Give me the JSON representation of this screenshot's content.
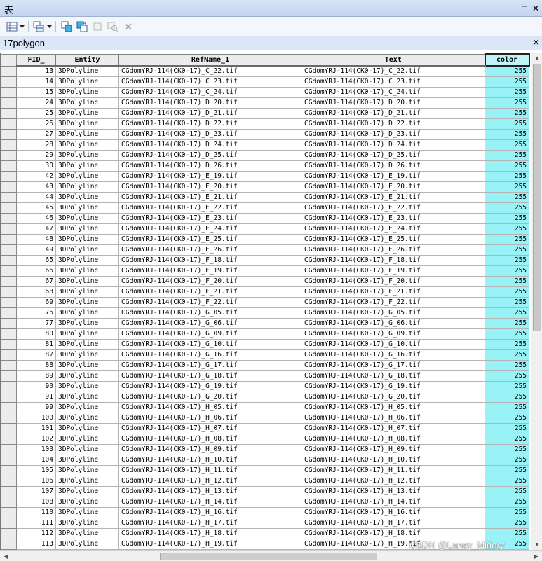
{
  "window": {
    "title": "表",
    "buttons": {
      "maximize": "□",
      "close": "✕"
    }
  },
  "tab": {
    "name": "17polygon",
    "close": "✕"
  },
  "table": {
    "columns": [
      "FID_",
      "Entity",
      "RefName_1",
      "Text",
      "color"
    ],
    "rows": [
      [
        "13",
        "3DPolyline",
        "CGdomYRJ-114(CK0-17)_C_22.tif",
        "CGdomYRJ-114(CK0-17)_C_22.tif",
        "255"
      ],
      [
        "14",
        "3DPolyline",
        "CGdomYRJ-114(CK0-17)_C_23.tif",
        "CGdomYRJ-114(CK0-17)_C_23.tif",
        "255"
      ],
      [
        "15",
        "3DPolyline",
        "CGdomYRJ-114(CK0-17)_C_24.tif",
        "CGdomYRJ-114(CK0-17)_C_24.tif",
        "255"
      ],
      [
        "24",
        "3DPolyline",
        "CGdomYRJ-114(CK0-17)_D_20.tif",
        "CGdomYRJ-114(CK0-17)_D_20.tif",
        "255"
      ],
      [
        "25",
        "3DPolyline",
        "CGdomYRJ-114(CK0-17)_D_21.tif",
        "CGdomYRJ-114(CK0-17)_D_21.tif",
        "255"
      ],
      [
        "26",
        "3DPolyline",
        "CGdomYRJ-114(CK0-17)_D_22.tif",
        "CGdomYRJ-114(CK0-17)_D_22.tif",
        "255"
      ],
      [
        "27",
        "3DPolyline",
        "CGdomYRJ-114(CK0-17)_D_23.tif",
        "CGdomYRJ-114(CK0-17)_D_23.tif",
        "255"
      ],
      [
        "28",
        "3DPolyline",
        "CGdomYRJ-114(CK0-17)_D_24.tif",
        "CGdomYRJ-114(CK0-17)_D_24.tif",
        "255"
      ],
      [
        "29",
        "3DPolyline",
        "CGdomYRJ-114(CK0-17)_D_25.tif",
        "CGdomYRJ-114(CK0-17)_D_25.tif",
        "255"
      ],
      [
        "30",
        "3DPolyline",
        "CGdomYRJ-114(CK0-17)_D_26.tif",
        "CGdomYRJ-114(CK0-17)_D_26.tif",
        "255"
      ],
      [
        "42",
        "3DPolyline",
        "CGdomYRJ-114(CK0-17)_E_19.tif",
        "CGdomYRJ-114(CK0-17)_E_19.tif",
        "255"
      ],
      [
        "43",
        "3DPolyline",
        "CGdomYRJ-114(CK0-17)_E_20.tif",
        "CGdomYRJ-114(CK0-17)_E_20.tif",
        "255"
      ],
      [
        "44",
        "3DPolyline",
        "CGdomYRJ-114(CK0-17)_E_21.tif",
        "CGdomYRJ-114(CK0-17)_E_21.tif",
        "255"
      ],
      [
        "45",
        "3DPolyline",
        "CGdomYRJ-114(CK0-17)_E_22.tif",
        "CGdomYRJ-114(CK0-17)_E_22.tif",
        "255"
      ],
      [
        "46",
        "3DPolyline",
        "CGdomYRJ-114(CK0-17)_E_23.tif",
        "CGdomYRJ-114(CK0-17)_E_23.tif",
        "255"
      ],
      [
        "47",
        "3DPolyline",
        "CGdomYRJ-114(CK0-17)_E_24.tif",
        "CGdomYRJ-114(CK0-17)_E_24.tif",
        "255"
      ],
      [
        "48",
        "3DPolyline",
        "CGdomYRJ-114(CK0-17)_E_25.tif",
        "CGdomYRJ-114(CK0-17)_E_25.tif",
        "255"
      ],
      [
        "49",
        "3DPolyline",
        "CGdomYRJ-114(CK0-17)_E_26.tif",
        "CGdomYRJ-114(CK0-17)_E_26.tif",
        "255"
      ],
      [
        "65",
        "3DPolyline",
        "CGdomYRJ-114(CK0-17)_F_18.tif",
        "CGdomYRJ-114(CK0-17)_F_18.tif",
        "255"
      ],
      [
        "66",
        "3DPolyline",
        "CGdomYRJ-114(CK0-17)_F_19.tif",
        "CGdomYRJ-114(CK0-17)_F_19.tif",
        "255"
      ],
      [
        "67",
        "3DPolyline",
        "CGdomYRJ-114(CK0-17)_F_20.tif",
        "CGdomYRJ-114(CK0-17)_F_20.tif",
        "255"
      ],
      [
        "68",
        "3DPolyline",
        "CGdomYRJ-114(CK0-17)_F_21.tif",
        "CGdomYRJ-114(CK0-17)_F_21.tif",
        "255"
      ],
      [
        "69",
        "3DPolyline",
        "CGdomYRJ-114(CK0-17)_F_22.tif",
        "CGdomYRJ-114(CK0-17)_F_22.tif",
        "255"
      ],
      [
        "76",
        "3DPolyline",
        "CGdomYRJ-114(CK0-17)_G_05.tif",
        "CGdomYRJ-114(CK0-17)_G_05.tif",
        "255"
      ],
      [
        "77",
        "3DPolyline",
        "CGdomYRJ-114(CK0-17)_G_06.tif",
        "CGdomYRJ-114(CK0-17)_G_06.tif",
        "255"
      ],
      [
        "80",
        "3DPolyline",
        "CGdomYRJ-114(CK0-17)_G_09.tif",
        "CGdomYRJ-114(CK0-17)_G_09.tif",
        "255"
      ],
      [
        "81",
        "3DPolyline",
        "CGdomYRJ-114(CK0-17)_G_10.tif",
        "CGdomYRJ-114(CK0-17)_G_10.tif",
        "255"
      ],
      [
        "87",
        "3DPolyline",
        "CGdomYRJ-114(CK0-17)_G_16.tif",
        "CGdomYRJ-114(CK0-17)_G_16.tif",
        "255"
      ],
      [
        "88",
        "3DPolyline",
        "CGdomYRJ-114(CK0-17)_G_17.tif",
        "CGdomYRJ-114(CK0-17)_G_17.tif",
        "255"
      ],
      [
        "89",
        "3DPolyline",
        "CGdomYRJ-114(CK0-17)_G_18.tif",
        "CGdomYRJ-114(CK0-17)_G_18.tif",
        "255"
      ],
      [
        "90",
        "3DPolyline",
        "CGdomYRJ-114(CK0-17)_G_19.tif",
        "CGdomYRJ-114(CK0-17)_G_19.tif",
        "255"
      ],
      [
        "91",
        "3DPolyline",
        "CGdomYRJ-114(CK0-17)_G_20.tif",
        "CGdomYRJ-114(CK0-17)_G_20.tif",
        "255"
      ],
      [
        "99",
        "3DPolyline",
        "CGdomYRJ-114(CK0-17)_H_05.tif",
        "CGdomYRJ-114(CK0-17)_H_05.tif",
        "255"
      ],
      [
        "100",
        "3DPolyline",
        "CGdomYRJ-114(CK0-17)_H_06.tif",
        "CGdomYRJ-114(CK0-17)_H_06.tif",
        "255"
      ],
      [
        "101",
        "3DPolyline",
        "CGdomYRJ-114(CK0-17)_H_07.tif",
        "CGdomYRJ-114(CK0-17)_H_07.tif",
        "255"
      ],
      [
        "102",
        "3DPolyline",
        "CGdomYRJ-114(CK0-17)_H_08.tif",
        "CGdomYRJ-114(CK0-17)_H_08.tif",
        "255"
      ],
      [
        "103",
        "3DPolyline",
        "CGdomYRJ-114(CK0-17)_H_09.tif",
        "CGdomYRJ-114(CK0-17)_H_09.tif",
        "255"
      ],
      [
        "104",
        "3DPolyline",
        "CGdomYRJ-114(CK0-17)_H_10.tif",
        "CGdomYRJ-114(CK0-17)_H_10.tif",
        "255"
      ],
      [
        "105",
        "3DPolyline",
        "CGdomYRJ-114(CK0-17)_H_11.tif",
        "CGdomYRJ-114(CK0-17)_H_11.tif",
        "255"
      ],
      [
        "106",
        "3DPolyline",
        "CGdomYRJ-114(CK0-17)_H_12.tif",
        "CGdomYRJ-114(CK0-17)_H_12.tif",
        "255"
      ],
      [
        "107",
        "3DPolyline",
        "CGdomYRJ-114(CK0-17)_H_13.tif",
        "CGdomYRJ-114(CK0-17)_H_13.tif",
        "255"
      ],
      [
        "108",
        "3DPolyline",
        "CGdomYRJ-114(CK0-17)_H_14.tif",
        "CGdomYRJ-114(CK0-17)_H_14.tif",
        "255"
      ],
      [
        "110",
        "3DPolyline",
        "CGdomYRJ-114(CK0-17)_H_16.tif",
        "CGdomYRJ-114(CK0-17)_H_16.tif",
        "255"
      ],
      [
        "111",
        "3DPolyline",
        "CGdomYRJ-114(CK0-17)_H_17.tif",
        "CGdomYRJ-114(CK0-17)_H_17.tif",
        "255"
      ],
      [
        "112",
        "3DPolyline",
        "CGdomYRJ-114(CK0-17)_H_18.tif",
        "CGdomYRJ-114(CK0-17)_H_18.tif",
        "255"
      ],
      [
        "113",
        "3DPolyline",
        "CGdomYRJ-114(CK0-17)_H_19.tif",
        "CGdomYRJ-114(CK0-17)_H_19.tif",
        "255"
      ]
    ]
  },
  "toolbar": {
    "icons": [
      "table-options-icon",
      "dropdown-arrow-icon",
      "related-tables-icon",
      "dropdown-arrow-icon",
      "select-by-attributes-icon",
      "switch-selection-icon",
      "clear-selection-icon",
      "zoom-to-selected-icon",
      "delete-selected-icon"
    ]
  },
  "watermark": "CSDN @Laney_Midory",
  "colors": {
    "accent_column": "#98f2f6",
    "titlebar": "#c9dbf2"
  }
}
